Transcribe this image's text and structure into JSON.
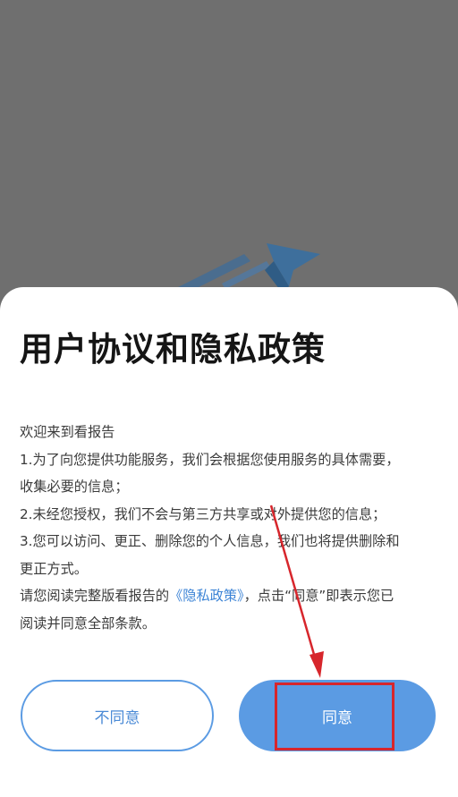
{
  "dialog": {
    "title": "用户协议和隐私政策",
    "greeting": "欢迎来到看报告",
    "point1_line1": "1.为了向您提供功能服务，我们会根据您使用服务的具体需要，",
    "point1_line2": "收集必要的信息；",
    "point2": "2.未经您授权，我们不会与第三方共享或对外提供您的信息；",
    "point3_line1": "3.您可以访问、更正、删除您的个人信息，我们也将提供删除和",
    "point3_line2": "更正方式。",
    "notice_prefix": "请您阅读完整版看报告的",
    "privacy_link": "《隐私政策》",
    "notice_suffix": "，点击“同意”即表示您已",
    "notice_line2": "阅读并同意全部条款。"
  },
  "buttons": {
    "disagree_label": "不同意",
    "agree_label": "同意"
  },
  "annotation": {
    "highlight_color": "#d7262c"
  },
  "colors": {
    "accent": "#5b9be3",
    "link": "#3d84d6",
    "overlay": "#6f6f6f"
  }
}
